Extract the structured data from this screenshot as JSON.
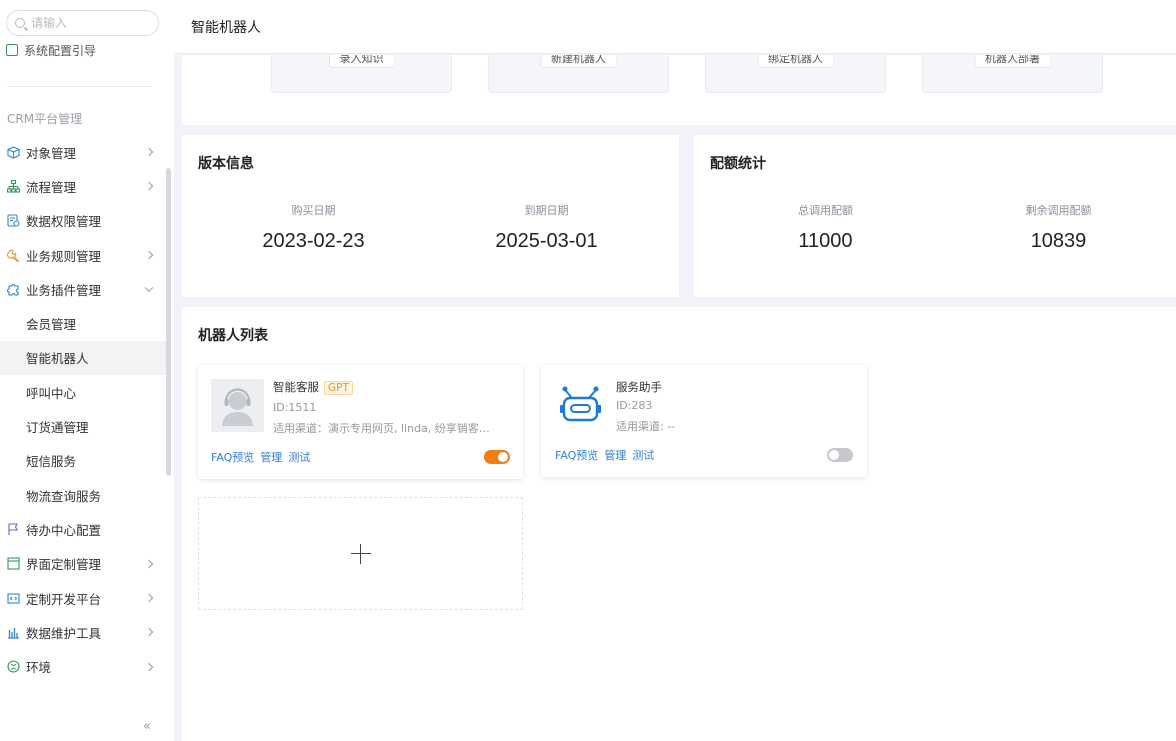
{
  "search": {
    "placeholder": "请输入"
  },
  "sidebar": {
    "partial_item": "系统配置引导",
    "section_label": "CRM平台管理",
    "items": [
      {
        "label": "对象管理",
        "icon": "cube-icon",
        "icon_color": "#2d86d9"
      },
      {
        "label": "流程管理",
        "icon": "flow-icon",
        "icon_color": "#2d9c5a"
      },
      {
        "label": "数据权限管理",
        "icon": "data-permission-icon",
        "icon_color": "#2d86d9"
      },
      {
        "label": "业务规则管理",
        "icon": "wrench-icon",
        "icon_color": "#e89a2c"
      },
      {
        "label": "业务插件管理",
        "icon": "plugin-icon",
        "icon_color": "#2d86d9"
      },
      {
        "label": "会员管理"
      },
      {
        "label": "智能机器人"
      },
      {
        "label": "呼叫中心"
      },
      {
        "label": "订货通管理"
      },
      {
        "label": "短信服务"
      },
      {
        "label": "物流查询服务"
      },
      {
        "label": "待办中心配置",
        "icon": "flag-icon",
        "icon_color": "#7c5ccf"
      },
      {
        "label": "界面定制管理",
        "icon": "layout-icon",
        "icon_color": "#2d9c5a"
      },
      {
        "label": "定制开发平台",
        "icon": "code-icon",
        "icon_color": "#2d86d9"
      },
      {
        "label": "数据维护工具",
        "icon": "bar-chart-icon",
        "icon_color": "#2d86d9"
      },
      {
        "label": "环境",
        "icon": "environment-icon",
        "icon_color": "#2d9c5a"
      }
    ],
    "collapse_label": "«"
  },
  "header": {
    "title": "智能机器人"
  },
  "quick_actions": [
    "录入知识",
    "新建机器人",
    "绑定机器人",
    "机器人部署"
  ],
  "version_info": {
    "title": "版本信息",
    "purchase_label": "购买日期",
    "purchase_date": "2023-02-23",
    "expire_label": "到期日期",
    "expire_date": "2025-03-01"
  },
  "quota": {
    "title": "配额统计",
    "total_label": "总调用配额",
    "total_value": "11000",
    "remaining_label": "剩余调用配额",
    "remaining_value": "10839"
  },
  "robot_list": {
    "title": "机器人列表",
    "robots": [
      {
        "name": "智能客服",
        "badge": "GPT",
        "id": "ID:1511",
        "channels": "适用渠道：演示专用网页, linda, 纷享销客互...",
        "links": [
          "FAQ预览",
          "管理",
          "测试"
        ],
        "enabled": true
      },
      {
        "name": "服务助手",
        "id": "ID:283",
        "channels": "适用渠道: --",
        "links": [
          "FAQ预览",
          "管理",
          "测试"
        ],
        "enabled": false
      }
    ],
    "add_symbol": "+"
  },
  "colors": {
    "accent": "#f57c10",
    "link": "#2f7de1"
  }
}
